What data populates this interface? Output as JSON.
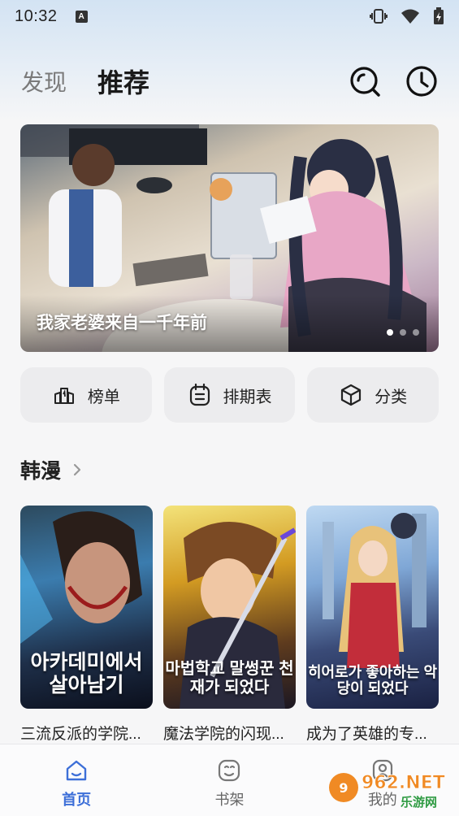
{
  "status_bar": {
    "time": "10:32",
    "notification_icon_letter": "A",
    "icons": [
      "vibrate-icon",
      "wifi-icon",
      "battery-icon"
    ]
  },
  "header": {
    "tabs": [
      {
        "label": "发现",
        "active": false
      },
      {
        "label": "推荐",
        "active": true
      }
    ],
    "icons": [
      "search-icon",
      "history-icon"
    ]
  },
  "banner": {
    "title": "我家老婆来自一千年前",
    "dots": 3,
    "active_dot": 0
  },
  "quick_links": [
    {
      "label": "榜单",
      "icon": "ranking-icon"
    },
    {
      "label": "排期表",
      "icon": "schedule-icon"
    },
    {
      "label": "分类",
      "icon": "category-icon"
    }
  ],
  "section": {
    "title": "韩漫"
  },
  "comics": [
    {
      "title": "三流反派的学院...",
      "cover_text": "아카데미에서 살아남기"
    },
    {
      "title": "魔法学院的闪现...",
      "cover_text": "마법학교 말썽꾼 천재가 되었다"
    },
    {
      "title": "成为了英雄的专...",
      "cover_text": "히어로가 좋아하는 악당이 되었다"
    }
  ],
  "bottom_nav": [
    {
      "label": "首页",
      "icon": "home-icon",
      "active": true
    },
    {
      "label": "书架",
      "icon": "bookshelf-icon",
      "active": false
    },
    {
      "label": "我的",
      "icon": "profile-icon",
      "active": false
    }
  ],
  "watermark": {
    "brand": "962.NET",
    "subtitle": "乐游网"
  },
  "colors": {
    "accent": "#3d6fd8",
    "background": "#f6f6f7",
    "card_bg": "#ececee"
  }
}
